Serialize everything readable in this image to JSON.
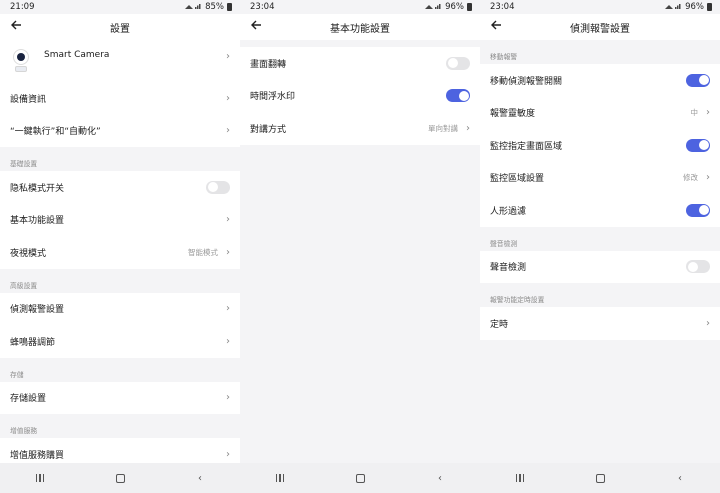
{
  "screens": [
    {
      "status": {
        "time": "21:09",
        "battery": "85%"
      },
      "title": "設置",
      "device": {
        "name": "Smart  Camera"
      },
      "items": {
        "device_info": "設備資訊",
        "automation": "“一鍵執行”和“自動化”",
        "section_basic": "基礎設置",
        "privacy": "隐私模式开关",
        "basic_func": "基本功能設置",
        "night_mode": "夜視模式",
        "night_mode_value": "智能模式",
        "section_advanced": "高級設置",
        "detection": "偵測報警設置",
        "buzzer": "蜂鳴器調節",
        "section_storage": "存儲",
        "storage": "存儲設置",
        "section_vas": "增值服務",
        "vas_buy": "增值服務購買"
      }
    },
    {
      "status": {
        "time": "23:04",
        "battery": "96%"
      },
      "title": "基本功能設置",
      "items": {
        "flip": "畫面翻轉",
        "watermark": "時間浮水印",
        "talk_mode": "對講方式",
        "talk_mode_value": "單向對講"
      }
    },
    {
      "status": {
        "time": "23:04",
        "battery": "96%"
      },
      "title": "偵測報警設置",
      "items": {
        "section_motion": "移動報警",
        "motion_switch": "移動偵測報警開關",
        "sensitivity": "報警靈敏度",
        "sensitivity_value": "中",
        "area_monitor": "監控指定畫面區域",
        "area_setting": "監控區域設置",
        "area_setting_value": "修改",
        "human_filter": "人形過濾",
        "section_sound": "聲音檢測",
        "sound_detect": "聲音檢測",
        "section_schedule": "報警功能定時設置",
        "schedule": "定時"
      }
    }
  ],
  "toggles": {
    "privacy": "off",
    "flip": "off",
    "watermark": "on",
    "motion_switch": "on",
    "area_monitor": "on",
    "human_filter": "on",
    "sound_detect": "off"
  },
  "colors": {
    "accent": "#4d63e0",
    "toggle_off": "#e4e4e6",
    "background": "#f4f4f6"
  }
}
